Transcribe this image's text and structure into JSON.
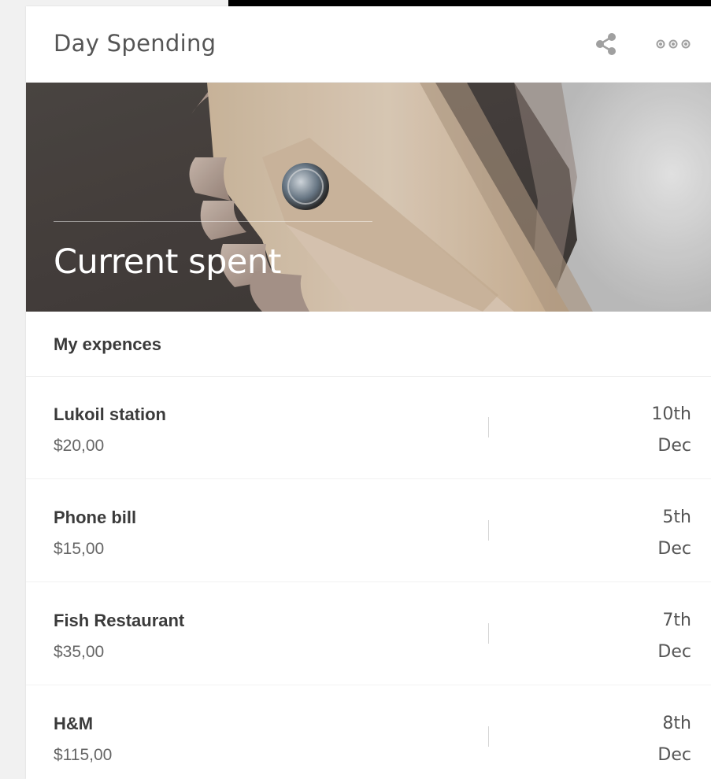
{
  "card": {
    "title": "Day Spending",
    "actions": {
      "share_icon": "share-icon",
      "more_icon": "more-horizontal-icon"
    }
  },
  "hero": {
    "title": "Current spent"
  },
  "section": {
    "title": "My expences"
  },
  "expenses": [
    {
      "name": "Lukoil station",
      "amount": "$20,00",
      "day": "10th",
      "month": "Dec"
    },
    {
      "name": "Phone bill",
      "amount": "$15,00",
      "day": "5th",
      "month": "Dec"
    },
    {
      "name": "Fish Restaurant",
      "amount": "$35,00",
      "day": "7th",
      "month": "Dec"
    },
    {
      "name": "H&M",
      "amount": "$115,00",
      "day": "8th",
      "month": "Dec"
    }
  ],
  "colors": {
    "icon": "#9a9a9a",
    "title_text": "#555555",
    "hero_overlay": "#4e4946"
  }
}
